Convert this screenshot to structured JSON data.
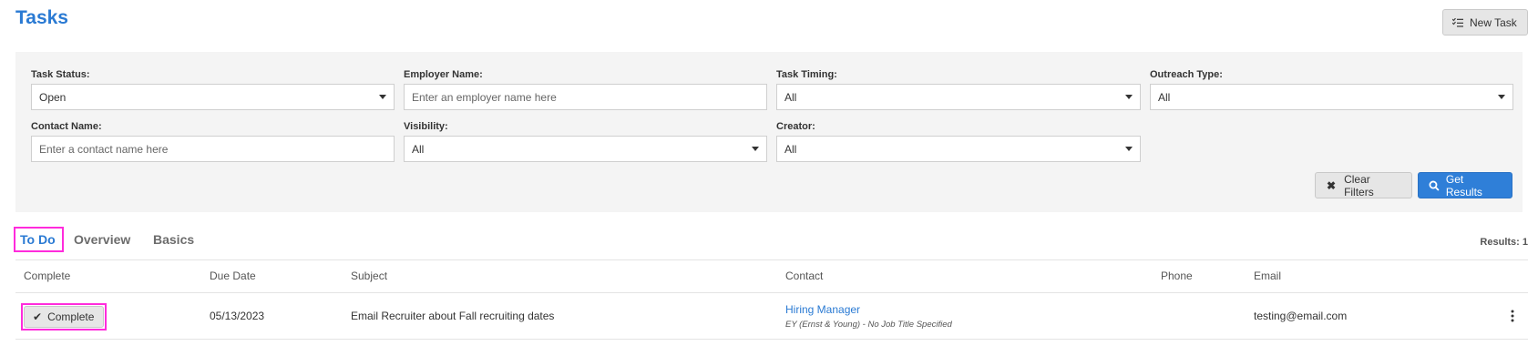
{
  "header": {
    "title": "Tasks",
    "new_task_label": "New Task"
  },
  "filters": {
    "task_status": {
      "label": "Task Status:",
      "value": "Open"
    },
    "employer_name": {
      "label": "Employer Name:",
      "placeholder": "Enter an employer name here"
    },
    "task_timing": {
      "label": "Task Timing:",
      "value": "All"
    },
    "outreach_type": {
      "label": "Outreach Type:",
      "value": "All"
    },
    "contact_name": {
      "label": "Contact Name:",
      "placeholder": "Enter a contact name here"
    },
    "visibility": {
      "label": "Visibility:",
      "value": "All"
    },
    "creator": {
      "label": "Creator:",
      "value": "All"
    },
    "clear_label": "Clear Filters",
    "get_results_label": "Get Results"
  },
  "tabs": [
    {
      "label": "To Do",
      "active": true
    },
    {
      "label": "Overview",
      "active": false
    },
    {
      "label": "Basics",
      "active": false
    }
  ],
  "results_label": "Results: 1",
  "table": {
    "columns": [
      "Complete",
      "Due Date",
      "Subject",
      "Contact",
      "Phone",
      "Email"
    ],
    "rows": [
      {
        "complete_label": "Complete",
        "due_date": "05/13/2023",
        "subject": "Email Recruiter about Fall recruiting dates",
        "contact_name": "Hiring Manager",
        "contact_detail": "EY (Ernst & Young) - No Job Title Specified",
        "phone": "",
        "email": "testing@email.com"
      }
    ]
  },
  "colors": {
    "accent": "#2a7ad3",
    "primary_button": "#2f7fd8",
    "highlight": "#ff2bdc"
  }
}
